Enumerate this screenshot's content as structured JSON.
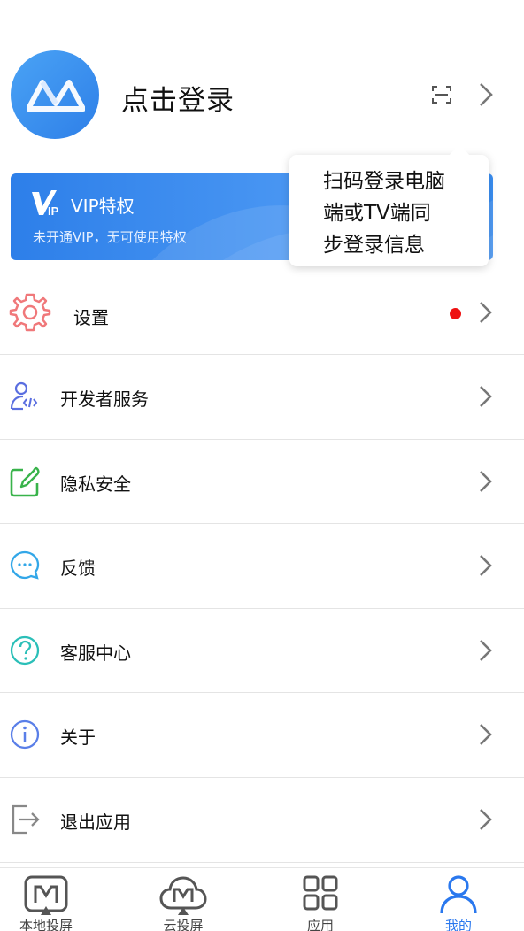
{
  "header": {
    "login_text": "点击登录"
  },
  "vip": {
    "title": "VIP特权",
    "subtitle": "未开通VIP，无可使用特权"
  },
  "tooltip": {
    "lines": [
      "扫码登录电脑",
      "端或TV端同",
      "步登录信息"
    ]
  },
  "menu": {
    "items": [
      {
        "label": "设置",
        "icon": "gear-icon",
        "badge": true
      },
      {
        "label": "开发者服务",
        "icon": "developer-icon"
      },
      {
        "label": "隐私安全",
        "icon": "privacy-edit-icon"
      },
      {
        "label": "反馈",
        "icon": "chat-bubble-icon"
      },
      {
        "label": "客服中心",
        "icon": "help-circle-icon"
      },
      {
        "label": "关于",
        "icon": "info-icon"
      },
      {
        "label": "退出应用",
        "icon": "exit-icon"
      }
    ]
  },
  "tabs": [
    {
      "label": "本地投屏",
      "icon": "local-cast-icon"
    },
    {
      "label": "云投屏",
      "icon": "cloud-cast-icon"
    },
    {
      "label": "应用",
      "icon": "apps-grid-icon"
    },
    {
      "label": "我的",
      "icon": "profile-icon",
      "active": true
    }
  ],
  "colors": {
    "accent": "#2a78ee",
    "badge": "#ee1111",
    "gear": "#f0787a",
    "developer": "#5a6ee0",
    "privacy": "#38b34a",
    "feedback": "#33a7e8",
    "help": "#2bbfb8",
    "info": "#5a7fe8",
    "exit": "#888888"
  }
}
